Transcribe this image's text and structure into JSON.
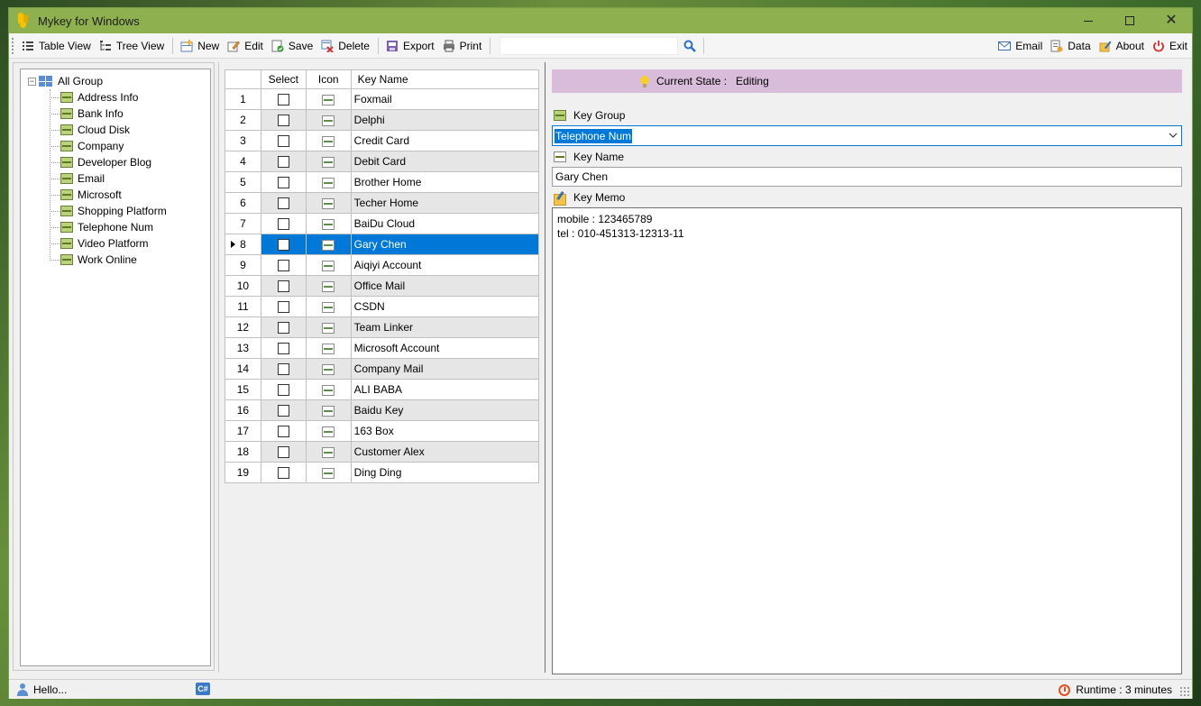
{
  "window": {
    "title": "Mykey for Windows"
  },
  "toolbar": {
    "table_view": "Table View",
    "tree_view": "Tree View",
    "new": "New",
    "edit": "Edit",
    "save": "Save",
    "delete": "Delete",
    "export": "Export",
    "print": "Print",
    "search_value": "",
    "email": "Email",
    "data": "Data",
    "about": "About",
    "exit": "Exit"
  },
  "tree": {
    "root": "All Group",
    "items": [
      "Address Info",
      "Bank Info",
      "Cloud Disk",
      "Company",
      "Developer Blog",
      "Email",
      "Microsoft",
      "Shopping Platform",
      "Telephone Num",
      "Video Platform",
      "Work Online"
    ]
  },
  "grid": {
    "headers": {
      "select": "Select",
      "icon": "Icon",
      "name": "Key Name"
    },
    "selected_row": 8,
    "rows": [
      {
        "num": "1",
        "name": "Foxmail"
      },
      {
        "num": "2",
        "name": "Delphi"
      },
      {
        "num": "3",
        "name": "Credit Card"
      },
      {
        "num": "4",
        "name": "Debit Card"
      },
      {
        "num": "5",
        "name": "Brother Home"
      },
      {
        "num": "6",
        "name": "Techer Home"
      },
      {
        "num": "7",
        "name": "BaiDu Cloud"
      },
      {
        "num": "8",
        "name": "Gary Chen"
      },
      {
        "num": "9",
        "name": "Aiqiyi Account"
      },
      {
        "num": "10",
        "name": "Office Mail"
      },
      {
        "num": "11",
        "name": "CSDN"
      },
      {
        "num": "12",
        "name": "Team Linker"
      },
      {
        "num": "13",
        "name": "Microsoft Account"
      },
      {
        "num": "14",
        "name": "Company Mail"
      },
      {
        "num": "15",
        "name": "ALI BABA"
      },
      {
        "num": "16",
        "name": "Baidu Key"
      },
      {
        "num": "17",
        "name": "163 Box"
      },
      {
        "num": "18",
        "name": "Customer Alex"
      },
      {
        "num": "19",
        "name": "Ding Ding"
      }
    ]
  },
  "detail": {
    "state_label": "Current State :",
    "state_value": "Editing",
    "group_label": "Key Group",
    "group_value": "Telephone Num",
    "name_label": "Key Name",
    "name_value": "Gary Chen",
    "memo_label": "Key Memo",
    "memo_lines": [
      "mobile : 123465789",
      "tel : 010-451313-12313-11"
    ]
  },
  "status": {
    "message": "Hello...",
    "runtime": "Runtime : 3 minutes"
  },
  "colors": {
    "titlebar": "#8fb04e",
    "selection": "#0078d7",
    "state_bar": "#d8bcd9"
  }
}
